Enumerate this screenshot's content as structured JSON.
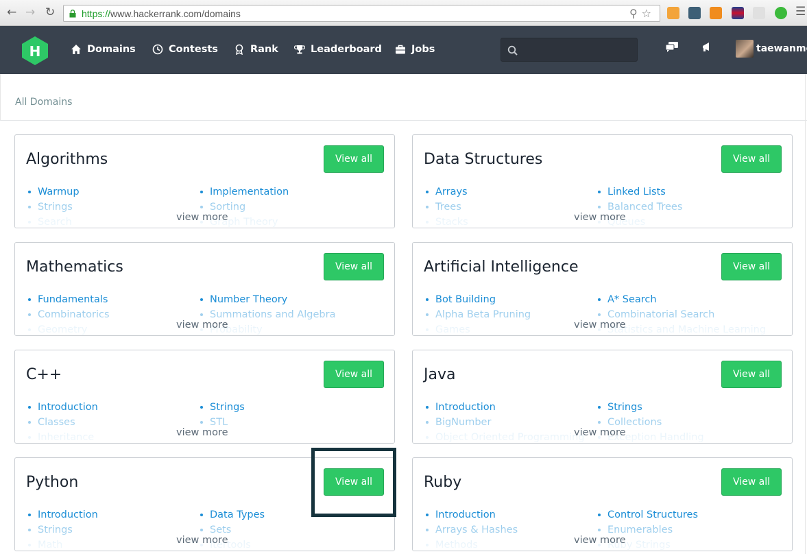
{
  "browser": {
    "url_scheme": "https://",
    "url_rest": "www.hackerrank.com/domains"
  },
  "nav": {
    "items": [
      {
        "label": "Domains",
        "icon": "home-icon"
      },
      {
        "label": "Contests",
        "icon": "clock-icon"
      },
      {
        "label": "Rank",
        "icon": "medal-icon"
      },
      {
        "label": "Leaderboard",
        "icon": "trophy-icon"
      },
      {
        "label": "Jobs",
        "icon": "briefcase-icon"
      }
    ],
    "search_placeholder": "",
    "username": "taewanme"
  },
  "breadcrumb": "All Domains",
  "colors": {
    "nav_bg": "#39424e",
    "accent_green": "#2ec866",
    "link_blue": "#1a8dd6",
    "logo_green": "#2ec866"
  },
  "view_all_label": "View all",
  "view_more_label": "view more",
  "domains": [
    {
      "title": "Algorithms",
      "col1": [
        "Warmup",
        "Strings",
        "Search"
      ],
      "col2": [
        "Implementation",
        "Sorting",
        "Graph Theory"
      ]
    },
    {
      "title": "Data Structures",
      "col1": [
        "Arrays",
        "Trees",
        "Stacks"
      ],
      "col2": [
        "Linked Lists",
        "Balanced Trees",
        "Queues"
      ]
    },
    {
      "title": "Mathematics",
      "col1": [
        "Fundamentals",
        "Combinatorics",
        "Geometry"
      ],
      "col2": [
        "Number Theory",
        "Summations and Algebra",
        "Probability"
      ]
    },
    {
      "title": "Artificial Intelligence",
      "col1": [
        "Bot Building",
        "Alpha Beta Pruning",
        "Games"
      ],
      "col2": [
        "A* Search",
        "Combinatorial Search",
        "Statistics and Machine Learning"
      ]
    },
    {
      "title": "C++",
      "col1": [
        "Introduction",
        "Classes",
        "Inheritance"
      ],
      "col2": [
        "Strings",
        "STL",
        ""
      ]
    },
    {
      "title": "Java",
      "col1": [
        "Introduction",
        "BigNumber",
        "Object Oriented Programming"
      ],
      "col2": [
        "Strings",
        "Collections",
        "Exception Handling"
      ]
    },
    {
      "title": "Python",
      "col1": [
        "Introduction",
        "Strings",
        "Math"
      ],
      "col2": [
        "Data Types",
        "Sets",
        "Itertools"
      ]
    },
    {
      "title": "Ruby",
      "col1": [
        "Introduction",
        "Arrays & Hashes",
        "Methods"
      ],
      "col2": [
        "Control Structures",
        "Enumerables",
        "Ruby Strings"
      ]
    }
  ]
}
